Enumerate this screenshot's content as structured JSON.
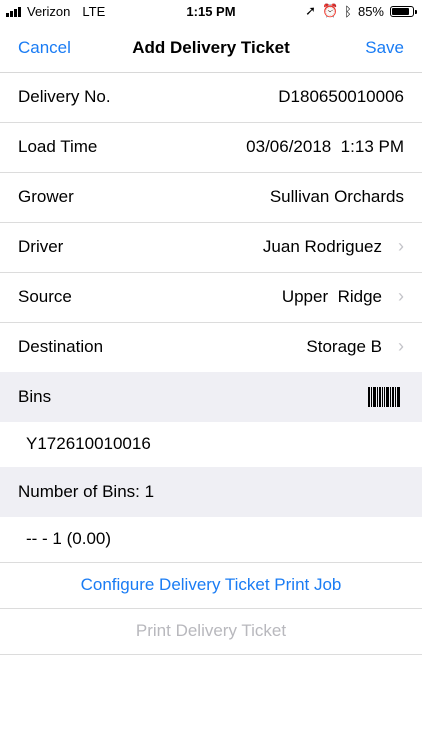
{
  "status_bar": {
    "carrier": "Verizon",
    "network": "LTE",
    "time": "1:15 PM",
    "battery": "85%",
    "battery_level": 0.85
  },
  "nav": {
    "cancel_label": "Cancel",
    "title": "Add Delivery Ticket",
    "save_label": "Save"
  },
  "fields": [
    {
      "label": "Delivery No.",
      "value": "D180650010006"
    },
    {
      "label": "Load Time",
      "value": "03/06/2018  1:13 PM"
    },
    {
      "label": "Grower",
      "value": "Sullivan Orchards"
    },
    {
      "label": "Driver",
      "value": "Juan Rodriguez"
    },
    {
      "label": "Source",
      "value": "Upper  Ridge"
    },
    {
      "label": "Destination",
      "value": "Storage B"
    }
  ],
  "bins_section": {
    "label": "Bins",
    "bin_id": "Y172610010016"
  },
  "count_section": {
    "label": "Number of Bins: 1",
    "entry": "-- - 1 (0.00)"
  },
  "actions": {
    "configure_label": "Configure Delivery Ticket Print Job",
    "print_label": "Print Delivery Ticket"
  },
  "colors": {
    "accent": "#1a7cf4",
    "disabled": "#b8b8bd",
    "section_bg": "#efeff4"
  }
}
